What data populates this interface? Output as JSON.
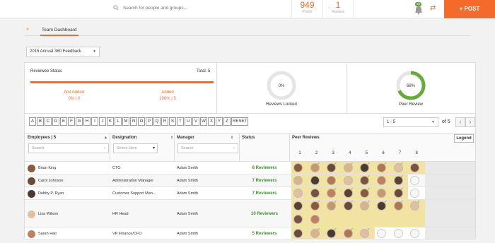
{
  "header": {
    "search_placeholder": "Search for people and groups...",
    "points_value": "949",
    "points_label": "Points",
    "ranked_value": "1",
    "ranked_label": "Ranked",
    "notif_count": "30",
    "post_label": "+ POST"
  },
  "tabs": {
    "active": "Team Dashboard"
  },
  "feedback_select": "2015 Annual 360 Feedback",
  "status": {
    "title": "Reviewee Status",
    "total": "Total: 5",
    "not_added_label": "Not Added",
    "not_added_value": "0% | 0",
    "added_label": "Added",
    "added_value": "100% | 5",
    "locked_pct": "0%",
    "locked_label": "Reviews Locked",
    "locked_fraction": 0,
    "peer_pct": "68%",
    "peer_label": "Peer Review",
    "peer_fraction": 0.68
  },
  "alphabet": [
    "A",
    "B",
    "C",
    "D",
    "E",
    "F",
    "G",
    "H",
    "I",
    "J",
    "K",
    "L",
    "M",
    "N",
    "O",
    "P",
    "Q",
    "R",
    "S",
    "T",
    "U",
    "V",
    "W",
    "X",
    "Y",
    "Z",
    "RESET"
  ],
  "pagination": {
    "range": "1 - 5",
    "of": "of 5"
  },
  "table": {
    "col_employees": "Employees | 5",
    "col_designation": "Designation",
    "col_manager": "Manager",
    "col_status": "Status",
    "col_peer": "Peer Reviews",
    "legend": "Legend",
    "search_employee": "Search",
    "select_designation": "Select Here",
    "search_manager": "Search",
    "peer_columns": [
      "1",
      "2",
      "3",
      "4",
      "5",
      "6",
      "7",
      "8"
    ],
    "rows": [
      {
        "name": "Brian King",
        "designation": "CTO",
        "manager": "Adam Smith",
        "status": "8 Reviewers",
        "reviewers": 8,
        "done": [
          0,
          1,
          1,
          1,
          1,
          1,
          1,
          0
        ]
      },
      {
        "name": "Carol Johnson",
        "designation": "Administration Manager",
        "manager": "Adam Smith",
        "status": "7 Reviewers",
        "reviewers": 7,
        "done": [
          0,
          0,
          0,
          0,
          1,
          0,
          1
        ]
      },
      {
        "name": "Debby P. Ryan",
        "designation": "Customer Support Man...",
        "manager": "Adam Smith",
        "status": "7 Reviewers",
        "reviewers": 7,
        "done": [
          0,
          0,
          1,
          1,
          1,
          0,
          1
        ]
      },
      {
        "name": "Lisa Wilson",
        "designation": "HR Head",
        "manager": "Adam Smith",
        "status": "10 Reviewers",
        "reviewers": 10,
        "done": [
          0,
          1,
          1,
          1,
          1,
          1,
          1,
          1,
          0,
          0
        ]
      },
      {
        "name": "Sarah Hall",
        "designation": "VP Finance/CFO",
        "manager": "Adam Smith",
        "status": "5 Reviewers",
        "reviewers": 5,
        "done": [
          0,
          1,
          1,
          1,
          1
        ]
      }
    ]
  },
  "colors": {
    "accent": "#f36a2a",
    "success": "#3f8f2a",
    "peer_bg": "#f3e3a3"
  }
}
